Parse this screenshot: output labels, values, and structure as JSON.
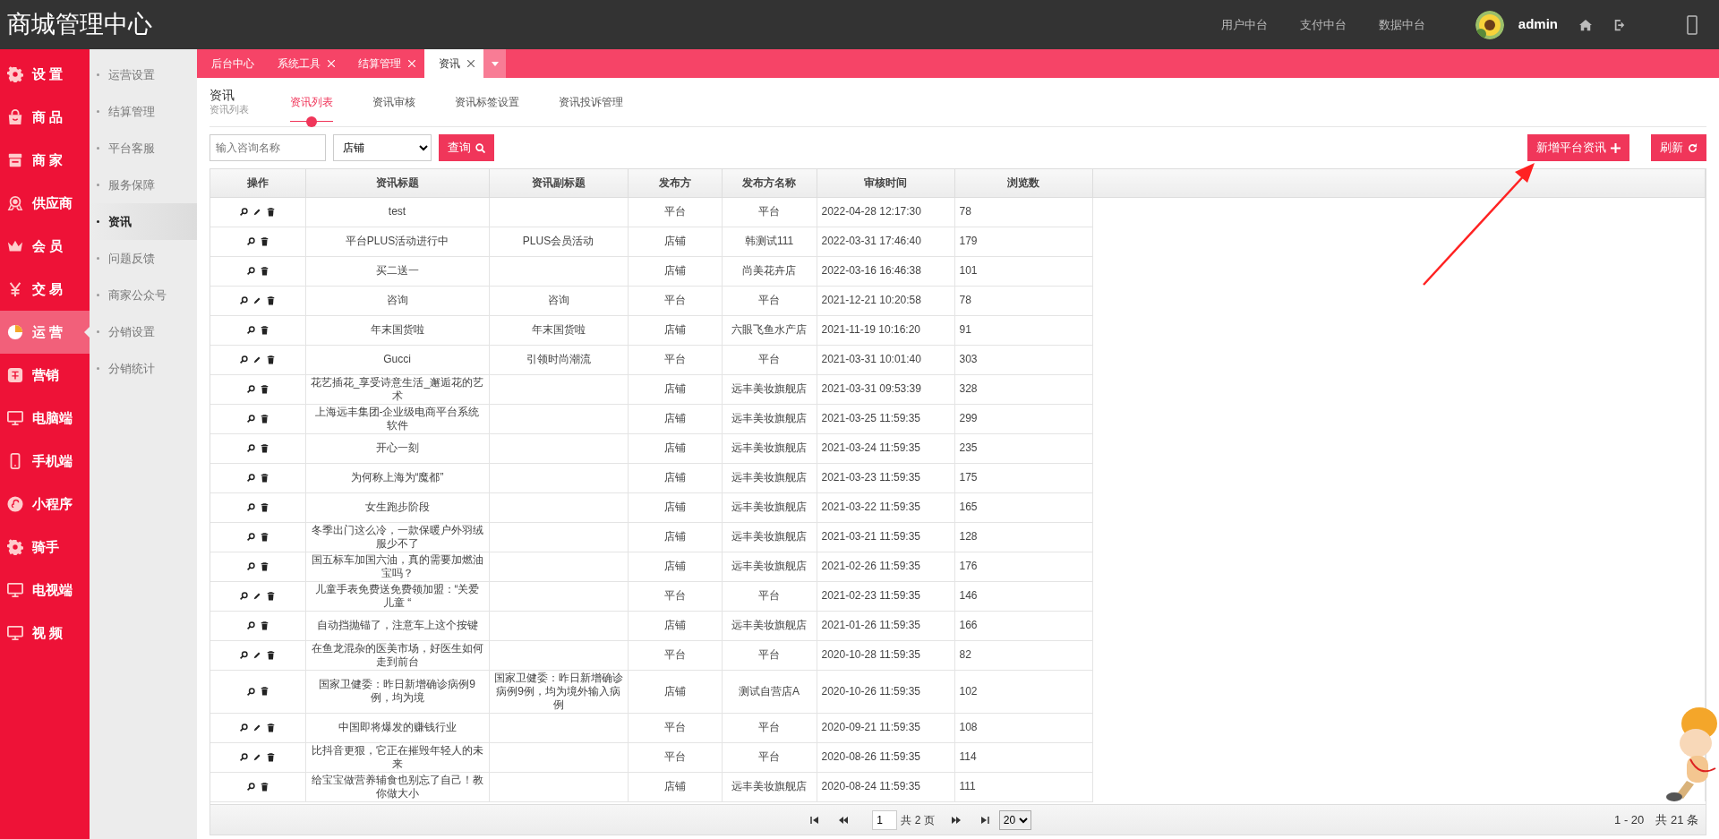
{
  "header": {
    "brand": "商城管理中心",
    "links": [
      "用户中台",
      "支付中台",
      "数据中台"
    ],
    "user": "admin"
  },
  "sidebar": {
    "items": [
      {
        "label": "设 置",
        "kind": "gear",
        "selected": false
      },
      {
        "label": "商 品",
        "kind": "bag",
        "selected": false
      },
      {
        "label": "商 家",
        "kind": "store",
        "selected": false
      },
      {
        "label": "供应商",
        "kind": "award",
        "selected": false
      },
      {
        "label": "会 员",
        "kind": "crown",
        "selected": false
      },
      {
        "label": "交 易",
        "kind": "yen",
        "selected": false
      },
      {
        "label": "运 营",
        "kind": "pie",
        "selected": true
      },
      {
        "label": "营销",
        "kind": "promo",
        "selected": false
      },
      {
        "label": "电脑端",
        "kind": "monitor",
        "selected": false
      },
      {
        "label": "手机端",
        "kind": "phone",
        "selected": false
      },
      {
        "label": "小程序",
        "kind": "mini",
        "selected": false
      },
      {
        "label": "骑手",
        "kind": "gear",
        "selected": false
      },
      {
        "label": "电视端",
        "kind": "monitor",
        "selected": false
      },
      {
        "label": "视 频",
        "kind": "monitor",
        "selected": false
      }
    ]
  },
  "submenu": {
    "items": [
      {
        "label": "运营设置",
        "selected": false
      },
      {
        "label": "结算管理",
        "selected": false
      },
      {
        "label": "平台客服",
        "selected": false
      },
      {
        "label": "服务保障",
        "selected": false
      },
      {
        "label": "资讯",
        "selected": true
      },
      {
        "label": "问题反馈",
        "selected": false
      },
      {
        "label": "商家公众号",
        "selected": false
      },
      {
        "label": "分销设置",
        "selected": false
      },
      {
        "label": "分销统计",
        "selected": false
      }
    ]
  },
  "tabs": [
    {
      "label": "后台中心",
      "selected": false,
      "closable": false
    },
    {
      "label": "系统工具",
      "selected": false,
      "closable": true
    },
    {
      "label": "结算管理",
      "selected": false,
      "closable": true
    },
    {
      "label": "资讯",
      "selected": true,
      "closable": true
    }
  ],
  "page": {
    "title": "资讯",
    "subtitle": "资讯列表"
  },
  "subtabs": [
    {
      "label": "资讯列表",
      "selected": true
    },
    {
      "label": "资讯审核",
      "selected": false
    },
    {
      "label": "资讯标签设置",
      "selected": false
    },
    {
      "label": "资讯投诉管理",
      "selected": false
    }
  ],
  "toolbar": {
    "search": {
      "placeholder": "输入咨询名称"
    },
    "filter": {
      "value": "店铺"
    },
    "query_button": "查询",
    "add_button": "新增平台资讯",
    "refresh_button": "刷新"
  },
  "table": {
    "columns": [
      "操作",
      "资讯标题",
      "资讯副标题",
      "发布方",
      "发布方名称",
      "审核时间",
      "浏览数"
    ],
    "rows": [
      {
        "editable": true,
        "title": "test",
        "subtitle": "",
        "publisher": "平台",
        "publisher_name": "平台",
        "review_time": "2022-04-28 12:17:30",
        "views": "78"
      },
      {
        "editable": false,
        "title": "平台PLUS活动进行中",
        "subtitle": "PLUS会员活动",
        "publisher": "店铺",
        "publisher_name": "韩测试111",
        "review_time": "2022-03-31 17:46:40",
        "views": "179"
      },
      {
        "editable": false,
        "title": "买二送一",
        "subtitle": "",
        "publisher": "店铺",
        "publisher_name": "尚美花卉店",
        "review_time": "2022-03-16 16:46:38",
        "views": "101"
      },
      {
        "editable": true,
        "title": "咨询",
        "subtitle": "咨询",
        "publisher": "平台",
        "publisher_name": "平台",
        "review_time": "2021-12-21 10:20:58",
        "views": "78"
      },
      {
        "editable": false,
        "title": "年末国货啦",
        "subtitle": "年末国货啦",
        "publisher": "店铺",
        "publisher_name": "六眼飞鱼水产店",
        "review_time": "2021-11-19 10:16:20",
        "views": "91"
      },
      {
        "editable": true,
        "title": "Gucci",
        "subtitle": "引领时尚潮流",
        "publisher": "平台",
        "publisher_name": "平台",
        "review_time": "2021-03-31 10:01:40",
        "views": "303"
      },
      {
        "editable": false,
        "title": "花艺插花_享受诗意生活_邂逅花的艺术",
        "subtitle": "",
        "publisher": "店铺",
        "publisher_name": "远丰美妆旗舰店",
        "review_time": "2021-03-31 09:53:39",
        "views": "328"
      },
      {
        "editable": false,
        "title": "上海远丰集团-企业级电商平台系统软件",
        "subtitle": "",
        "publisher": "店铺",
        "publisher_name": "远丰美妆旗舰店",
        "review_time": "2021-03-25 11:59:35",
        "views": "299"
      },
      {
        "editable": false,
        "title": "开心一刻",
        "subtitle": "",
        "publisher": "店铺",
        "publisher_name": "远丰美妆旗舰店",
        "review_time": "2021-03-24 11:59:35",
        "views": "235"
      },
      {
        "editable": false,
        "title": "为何称上海为“魔都”",
        "subtitle": "",
        "publisher": "店铺",
        "publisher_name": "远丰美妆旗舰店",
        "review_time": "2021-03-23 11:59:35",
        "views": "175"
      },
      {
        "editable": false,
        "title": "女生跑步阶段",
        "subtitle": "",
        "publisher": "店铺",
        "publisher_name": "远丰美妆旗舰店",
        "review_time": "2021-03-22 11:59:35",
        "views": "165"
      },
      {
        "editable": false,
        "title": "冬季出门这么冷，一款保暖户外羽绒服少不了",
        "subtitle": "",
        "publisher": "店铺",
        "publisher_name": "远丰美妆旗舰店",
        "review_time": "2021-03-21 11:59:35",
        "views": "128"
      },
      {
        "editable": false,
        "title": "国五标车加国六油，真的需要加燃油宝吗？",
        "subtitle": "",
        "publisher": "店铺",
        "publisher_name": "远丰美妆旗舰店",
        "review_time": "2021-02-26 11:59:35",
        "views": "176"
      },
      {
        "editable": true,
        "title": "儿童手表免费送免费领加盟：“关爱儿童 “",
        "subtitle": "",
        "publisher": "平台",
        "publisher_name": "平台",
        "review_time": "2021-02-23 11:59:35",
        "views": "146"
      },
      {
        "editable": false,
        "title": "自动挡抛锚了，注意车上这个按键",
        "subtitle": "",
        "publisher": "店铺",
        "publisher_name": "远丰美妆旗舰店",
        "review_time": "2021-01-26 11:59:35",
        "views": "166"
      },
      {
        "editable": true,
        "title": "在鱼龙混杂的医美市场，好医生如何走到前台",
        "subtitle": "",
        "publisher": "平台",
        "publisher_name": "平台",
        "review_time": "2020-10-28 11:59:35",
        "views": "82"
      },
      {
        "editable": false,
        "title": "国家卫健委：昨日新增确诊病例9例，均为境",
        "subtitle": "国家卫健委：昨日新增确诊病例9例，均为境外输入病例",
        "publisher": "店铺",
        "publisher_name": "测试自营店A",
        "review_time": "2020-10-26 11:59:35",
        "views": "102"
      },
      {
        "editable": true,
        "title": "中国即将爆发的赚钱行业",
        "subtitle": "",
        "publisher": "平台",
        "publisher_name": "平台",
        "review_time": "2020-09-21 11:59:35",
        "views": "108"
      },
      {
        "editable": true,
        "title": "比抖音更狠，它正在摧毁年轻人的未来",
        "subtitle": "",
        "publisher": "平台",
        "publisher_name": "平台",
        "review_time": "2020-08-26 11:59:35",
        "views": "114"
      },
      {
        "editable": false,
        "title": "给宝宝做营养辅食也别忘了自己！教你做大小",
        "subtitle": "",
        "publisher": "店铺",
        "publisher_name": "远丰美妆旗舰店",
        "review_time": "2020-08-24 11:59:35",
        "views": "111"
      }
    ]
  },
  "pagination": {
    "page": "1",
    "total_pages": "共 2 页",
    "page_size": "20",
    "summary": "1 - 20　共 21 条"
  }
}
